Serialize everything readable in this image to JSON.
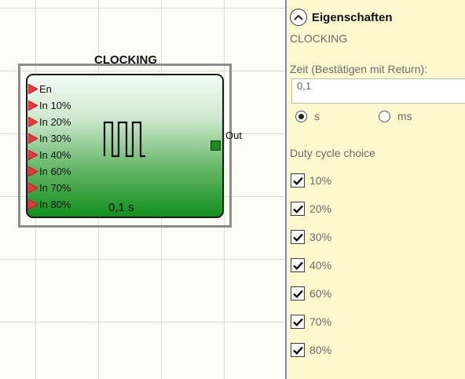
{
  "block": {
    "title": "CLOCKING",
    "inputs": [
      {
        "label": "En"
      },
      {
        "label": "In 10%"
      },
      {
        "label": "In 20%"
      },
      {
        "label": "In 30%"
      },
      {
        "label": "In 40%"
      },
      {
        "label": "In 60%"
      },
      {
        "label": "In 70%"
      },
      {
        "label": "In 80%"
      }
    ],
    "output_label": "Out",
    "time_value": "0,1 s"
  },
  "panel": {
    "title": "Eigenschaften",
    "subtitle": "CLOCKING",
    "time_field_label": "Zeit (Bestätigen mit Return):",
    "time_field_value": "0,1",
    "units": [
      {
        "label": "s",
        "selected": true
      },
      {
        "label": "ms",
        "selected": false
      }
    ],
    "duty_label": "Duty cycle choice",
    "duty_options": [
      {
        "label": "10%",
        "checked": true
      },
      {
        "label": "20%",
        "checked": true
      },
      {
        "label": "30%",
        "checked": true
      },
      {
        "label": "40%",
        "checked": true
      },
      {
        "label": "60%",
        "checked": true
      },
      {
        "label": "70%",
        "checked": true
      },
      {
        "label": "80%",
        "checked": true
      }
    ]
  },
  "colors": {
    "panel_bg": "#fef8cf",
    "pin_arrow": "#e8383d",
    "block_green": "#138f1d",
    "output_pin": "#1c8a1f"
  }
}
